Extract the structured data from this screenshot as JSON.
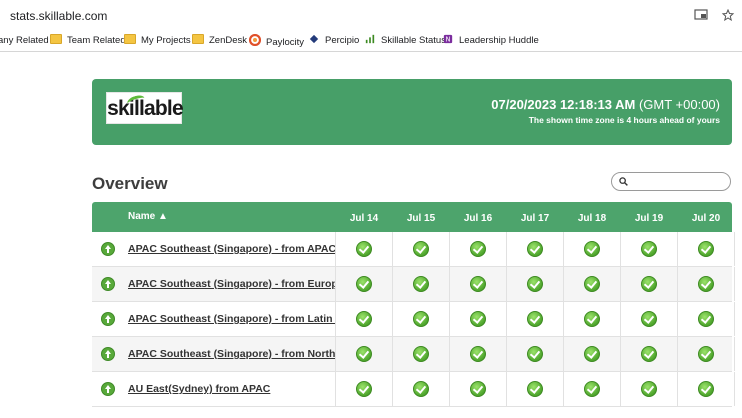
{
  "browser": {
    "url": "stats.skillable.com",
    "bookmarks": [
      {
        "label": "any Related",
        "icon": "folder-icon"
      },
      {
        "label": "Team Related",
        "icon": "folder-icon"
      },
      {
        "label": "My Projects",
        "icon": "folder-icon"
      },
      {
        "label": "ZenDesk",
        "icon": "folder-icon"
      },
      {
        "label": "Paylocity",
        "icon": "paylocity-icon"
      },
      {
        "label": "Percipio",
        "icon": "percipio-icon"
      },
      {
        "label": "Skillable Status",
        "icon": "status-icon"
      },
      {
        "label": "Leadership Huddle",
        "icon": "onenote-icon"
      }
    ]
  },
  "header": {
    "logo_text": "skillable",
    "time": "07/20/2023 12:18:13 AM",
    "timezone": "(GMT +00:00)",
    "note": "The shown time zone is 4 hours ahead of yours",
    "accent": "#479f68"
  },
  "overview": {
    "title": "Overview",
    "search_placeholder": ""
  },
  "table": {
    "name_header": "Name ▲",
    "days": [
      "Jul 14",
      "Jul 15",
      "Jul 16",
      "Jul 17",
      "Jul 18",
      "Jul 19",
      "Jul 20"
    ],
    "rows": [
      {
        "name": "APAC Southeast (Singapore) - from APAC",
        "status": "up",
        "days": [
          "ok",
          "ok",
          "ok",
          "ok",
          "ok",
          "ok",
          "ok"
        ]
      },
      {
        "name": "APAC Southeast (Singapore) - from Europe",
        "status": "up",
        "days": [
          "ok",
          "ok",
          "ok",
          "ok",
          "ok",
          "ok",
          "ok"
        ]
      },
      {
        "name": "APAC Southeast (Singapore) - from Latin America",
        "status": "up",
        "days": [
          "ok",
          "ok",
          "ok",
          "ok",
          "ok",
          "ok",
          "ok"
        ]
      },
      {
        "name": "APAC Southeast (Singapore) - from North America",
        "status": "up",
        "days": [
          "ok",
          "ok",
          "ok",
          "ok",
          "ok",
          "ok",
          "ok"
        ]
      },
      {
        "name": "AU East(Sydney) from APAC",
        "status": "up",
        "days": [
          "ok",
          "ok",
          "ok",
          "ok",
          "ok",
          "ok",
          "ok"
        ]
      }
    ]
  }
}
